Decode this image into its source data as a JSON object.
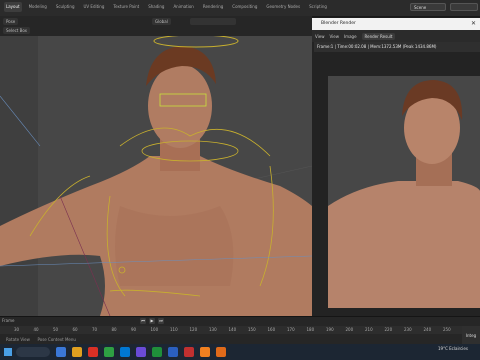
{
  "workspace_tabs": [
    "Layout",
    "Modeling",
    "Sculpting",
    "UV Editing",
    "Texture Paint",
    "Shading",
    "Animation",
    "Rendering",
    "Compositing",
    "Geometry Nodes",
    "Scripting"
  ],
  "active_tab": "Layout",
  "scene": {
    "label": "Scene"
  },
  "viewport": {
    "mode": "Pose",
    "select": "Select Box",
    "orientation": "Global"
  },
  "render_window": {
    "title": "Blender Render",
    "menu": [
      "View",
      "View",
      "Image"
    ],
    "view_layer": "Render Result",
    "info": "Frame:1 | Time:00:02.08 | Mem:1372.53M (Peak 1434.86M)"
  },
  "timeline": {
    "frame_label": "Frame",
    "ticks": [
      "30",
      "40",
      "50",
      "60",
      "70",
      "80",
      "90",
      "100",
      "110",
      "120",
      "130",
      "140",
      "150",
      "160",
      "170",
      "180",
      "190",
      "200",
      "210",
      "220",
      "230",
      "240",
      "250"
    ],
    "status_left": "Rotate View",
    "status_mid": "Pose Context Menu",
    "current_frame": "Integ"
  },
  "taskbar": {
    "weather": "19°C Eclaircies"
  },
  "colors": {
    "rig": "#c8b02e",
    "skin": "#b88468",
    "accent": "#e06a1a"
  }
}
